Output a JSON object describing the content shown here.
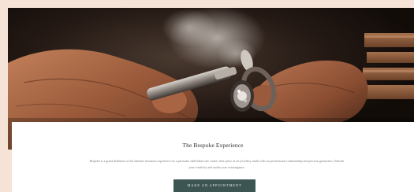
{
  "hero": {
    "image_alt": "Jeweller polishing a ring with a rotary tool"
  },
  "section": {
    "title": "The Bespoke Experience",
    "description": "Bespoke is a grand definition of the ultimate luxurious experience for a particular individual who creates their piece of art jewellery made with our professional craftmanship and precious gemstones. Unleash your creativity and awake your extravaganza.",
    "cta_label": "MAKE AN APPOINTMENT"
  },
  "colors": {
    "page_background": "#f4e3d6",
    "content_background": "#ffffff",
    "cta_background": "#3c5552",
    "cta_text": "#e9efee"
  }
}
